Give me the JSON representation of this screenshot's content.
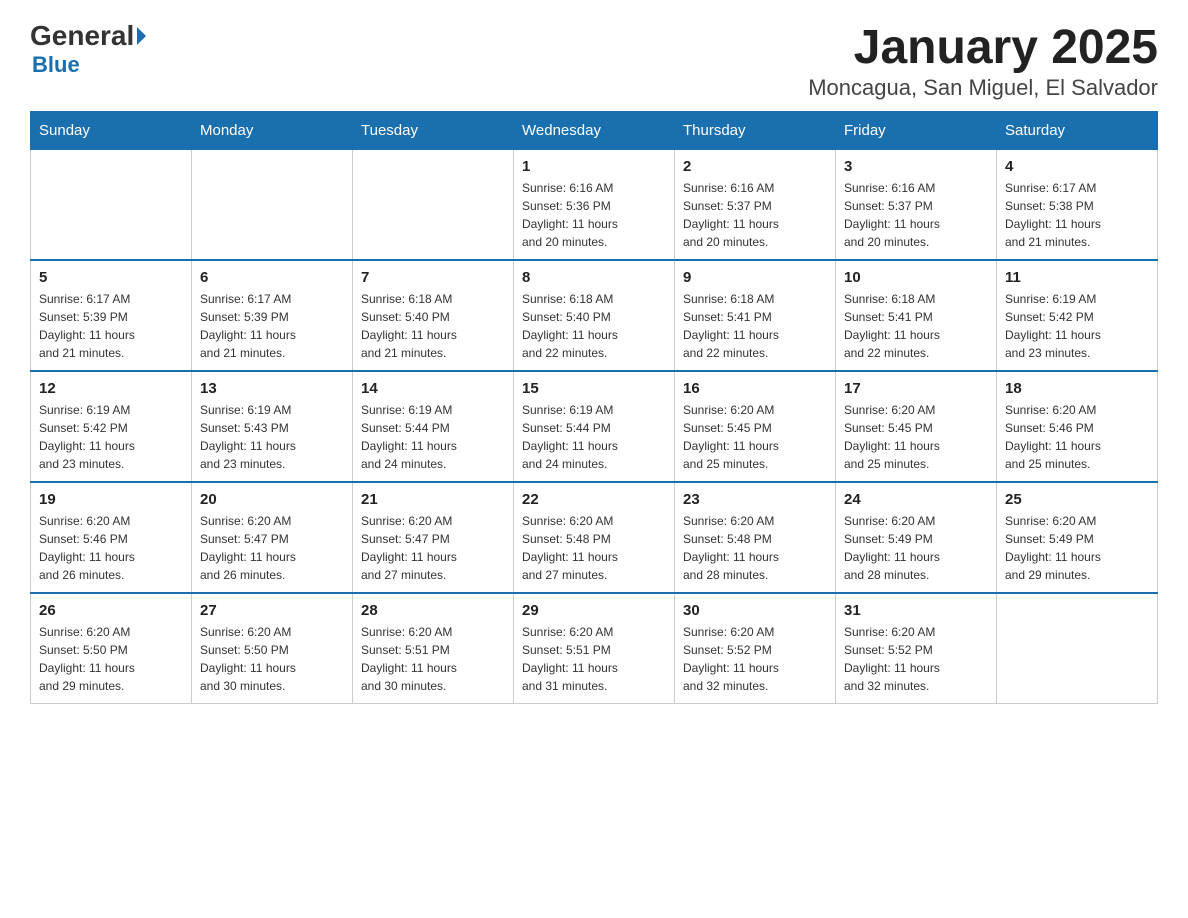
{
  "header": {
    "logo_general": "General",
    "logo_blue": "Blue",
    "title": "January 2025",
    "subtitle": "Moncagua, San Miguel, El Salvador"
  },
  "calendar": {
    "days_of_week": [
      "Sunday",
      "Monday",
      "Tuesday",
      "Wednesday",
      "Thursday",
      "Friday",
      "Saturday"
    ],
    "weeks": [
      [
        {
          "day": "",
          "info": ""
        },
        {
          "day": "",
          "info": ""
        },
        {
          "day": "",
          "info": ""
        },
        {
          "day": "1",
          "info": "Sunrise: 6:16 AM\nSunset: 5:36 PM\nDaylight: 11 hours\nand 20 minutes."
        },
        {
          "day": "2",
          "info": "Sunrise: 6:16 AM\nSunset: 5:37 PM\nDaylight: 11 hours\nand 20 minutes."
        },
        {
          "day": "3",
          "info": "Sunrise: 6:16 AM\nSunset: 5:37 PM\nDaylight: 11 hours\nand 20 minutes."
        },
        {
          "day": "4",
          "info": "Sunrise: 6:17 AM\nSunset: 5:38 PM\nDaylight: 11 hours\nand 21 minutes."
        }
      ],
      [
        {
          "day": "5",
          "info": "Sunrise: 6:17 AM\nSunset: 5:39 PM\nDaylight: 11 hours\nand 21 minutes."
        },
        {
          "day": "6",
          "info": "Sunrise: 6:17 AM\nSunset: 5:39 PM\nDaylight: 11 hours\nand 21 minutes."
        },
        {
          "day": "7",
          "info": "Sunrise: 6:18 AM\nSunset: 5:40 PM\nDaylight: 11 hours\nand 21 minutes."
        },
        {
          "day": "8",
          "info": "Sunrise: 6:18 AM\nSunset: 5:40 PM\nDaylight: 11 hours\nand 22 minutes."
        },
        {
          "day": "9",
          "info": "Sunrise: 6:18 AM\nSunset: 5:41 PM\nDaylight: 11 hours\nand 22 minutes."
        },
        {
          "day": "10",
          "info": "Sunrise: 6:18 AM\nSunset: 5:41 PM\nDaylight: 11 hours\nand 22 minutes."
        },
        {
          "day": "11",
          "info": "Sunrise: 6:19 AM\nSunset: 5:42 PM\nDaylight: 11 hours\nand 23 minutes."
        }
      ],
      [
        {
          "day": "12",
          "info": "Sunrise: 6:19 AM\nSunset: 5:42 PM\nDaylight: 11 hours\nand 23 minutes."
        },
        {
          "day": "13",
          "info": "Sunrise: 6:19 AM\nSunset: 5:43 PM\nDaylight: 11 hours\nand 23 minutes."
        },
        {
          "day": "14",
          "info": "Sunrise: 6:19 AM\nSunset: 5:44 PM\nDaylight: 11 hours\nand 24 minutes."
        },
        {
          "day": "15",
          "info": "Sunrise: 6:19 AM\nSunset: 5:44 PM\nDaylight: 11 hours\nand 24 minutes."
        },
        {
          "day": "16",
          "info": "Sunrise: 6:20 AM\nSunset: 5:45 PM\nDaylight: 11 hours\nand 25 minutes."
        },
        {
          "day": "17",
          "info": "Sunrise: 6:20 AM\nSunset: 5:45 PM\nDaylight: 11 hours\nand 25 minutes."
        },
        {
          "day": "18",
          "info": "Sunrise: 6:20 AM\nSunset: 5:46 PM\nDaylight: 11 hours\nand 25 minutes."
        }
      ],
      [
        {
          "day": "19",
          "info": "Sunrise: 6:20 AM\nSunset: 5:46 PM\nDaylight: 11 hours\nand 26 minutes."
        },
        {
          "day": "20",
          "info": "Sunrise: 6:20 AM\nSunset: 5:47 PM\nDaylight: 11 hours\nand 26 minutes."
        },
        {
          "day": "21",
          "info": "Sunrise: 6:20 AM\nSunset: 5:47 PM\nDaylight: 11 hours\nand 27 minutes."
        },
        {
          "day": "22",
          "info": "Sunrise: 6:20 AM\nSunset: 5:48 PM\nDaylight: 11 hours\nand 27 minutes."
        },
        {
          "day": "23",
          "info": "Sunrise: 6:20 AM\nSunset: 5:48 PM\nDaylight: 11 hours\nand 28 minutes."
        },
        {
          "day": "24",
          "info": "Sunrise: 6:20 AM\nSunset: 5:49 PM\nDaylight: 11 hours\nand 28 minutes."
        },
        {
          "day": "25",
          "info": "Sunrise: 6:20 AM\nSunset: 5:49 PM\nDaylight: 11 hours\nand 29 minutes."
        }
      ],
      [
        {
          "day": "26",
          "info": "Sunrise: 6:20 AM\nSunset: 5:50 PM\nDaylight: 11 hours\nand 29 minutes."
        },
        {
          "day": "27",
          "info": "Sunrise: 6:20 AM\nSunset: 5:50 PM\nDaylight: 11 hours\nand 30 minutes."
        },
        {
          "day": "28",
          "info": "Sunrise: 6:20 AM\nSunset: 5:51 PM\nDaylight: 11 hours\nand 30 minutes."
        },
        {
          "day": "29",
          "info": "Sunrise: 6:20 AM\nSunset: 5:51 PM\nDaylight: 11 hours\nand 31 minutes."
        },
        {
          "day": "30",
          "info": "Sunrise: 6:20 AM\nSunset: 5:52 PM\nDaylight: 11 hours\nand 32 minutes."
        },
        {
          "day": "31",
          "info": "Sunrise: 6:20 AM\nSunset: 5:52 PM\nDaylight: 11 hours\nand 32 minutes."
        },
        {
          "day": "",
          "info": ""
        }
      ]
    ]
  }
}
